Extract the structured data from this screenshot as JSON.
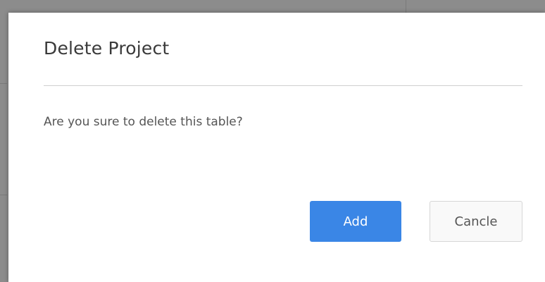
{
  "dialog": {
    "title": "Delete Project",
    "message": "Are you sure to delete this table?",
    "primary_button_label": "Add",
    "secondary_button_label": "Cancle"
  },
  "colors": {
    "primary_button": "#3a86e6",
    "overlay": "#8c8c8c",
    "dialog_background": "#ffffff"
  }
}
